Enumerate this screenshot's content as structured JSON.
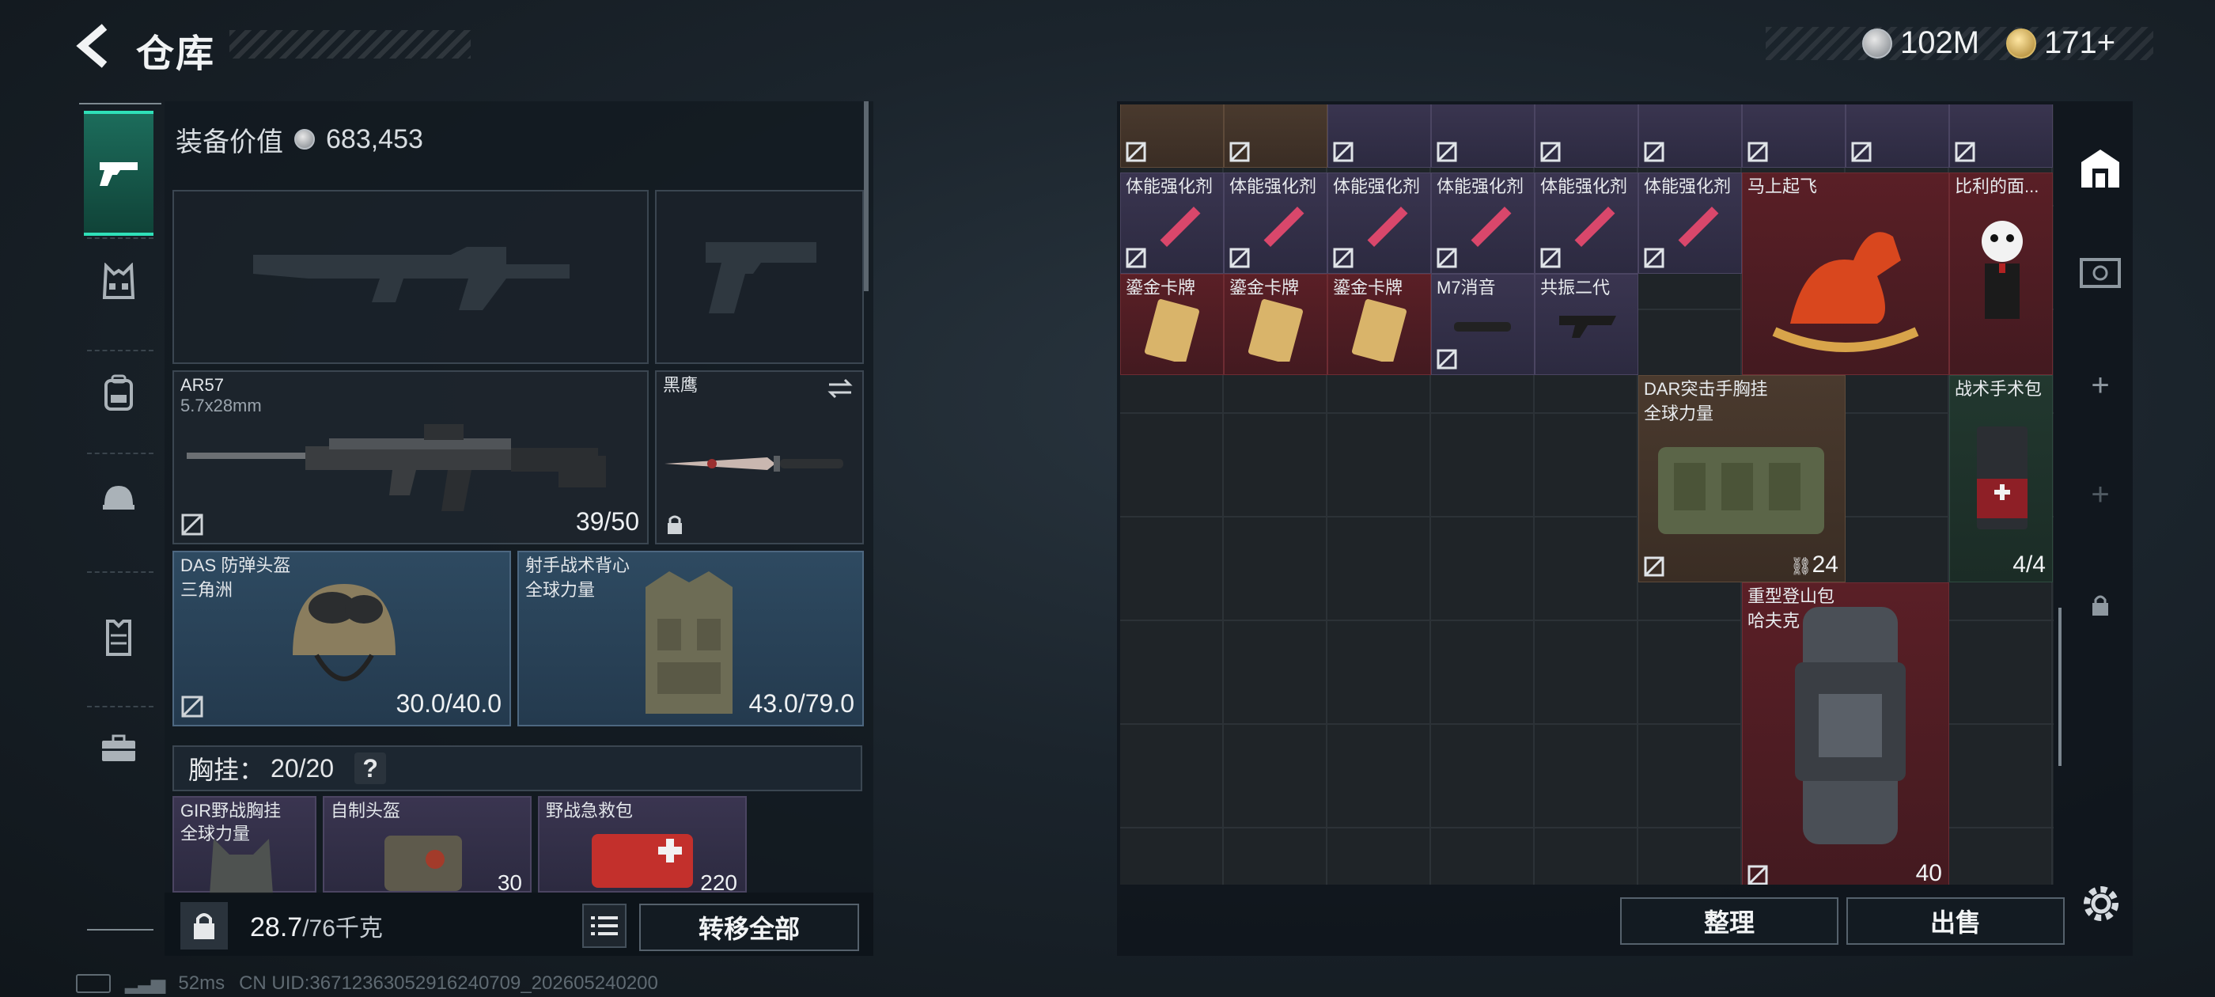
{
  "header": {
    "title": "仓库",
    "currency_money": "102M",
    "currency_gold": "171+"
  },
  "loadout": {
    "equip_value_label": "装备价值",
    "equip_value": "683,453",
    "primary": {
      "name": "AR57",
      "ammo": "5.7x28mm",
      "durability": "39/50"
    },
    "melee": {
      "name": "黑鹰"
    },
    "helmet": {
      "name": "DAS 防弹头盔",
      "brand": "三角洲",
      "durability": "30.0/40.0"
    },
    "armor": {
      "name": "射手战术背心",
      "brand": "全球力量",
      "durability": "43.0/79.0"
    },
    "chest_header": {
      "label": "胸挂：",
      "value": "20/20",
      "help": "?"
    },
    "chest_items": [
      {
        "name": "GIR野战胸挂",
        "sub": "全球力量"
      },
      {
        "name": "自制头盔",
        "count": "30"
      },
      {
        "name": "野战急救包",
        "count": "220"
      }
    ],
    "footer": {
      "weight": "28.7",
      "weight_cap": "/76千克",
      "transfer_all": "转移全部"
    }
  },
  "storage": {
    "tidy_label": "整理",
    "sell_label": "出售",
    "items": {
      "stim": "体能强化剂",
      "horse": "马上起飞",
      "billy": "比利的面...",
      "gold_card": "鎏金卡牌",
      "m7": "M7消音",
      "resonance": "共振二代",
      "dar_name": "DAR突击手胸挂",
      "dar_brand": "全球力量",
      "dar_count": "24",
      "medkit_name": "战术手术包",
      "medkit_count": "4/4",
      "backpack_name": "重型登山包",
      "backpack_brand": "哈夫克",
      "backpack_count": "40"
    }
  },
  "status": {
    "ping": "52ms",
    "uid": "CN UID:3671236305291624070​9_202605240200"
  },
  "colors": {
    "nav_active": "#1c6c5b",
    "rarity_red": "#5a1f26",
    "rarity_purple": "#3a3550",
    "rarity_gold": "#4a3a2e",
    "rarity_green": "#22382f"
  }
}
